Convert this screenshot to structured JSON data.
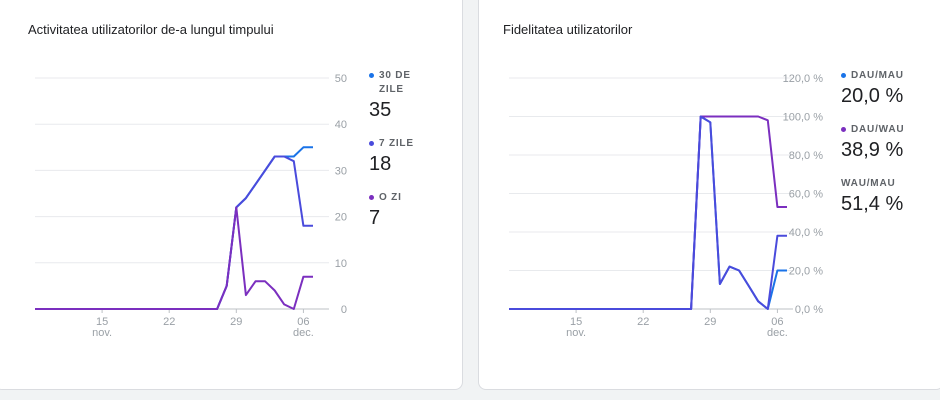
{
  "cards": [
    {
      "title": "Activitatea utilizatorilor de-a lungul timpului"
    },
    {
      "title": "Fidelitatea utilizatorilor"
    }
  ],
  "legend_left": [
    {
      "label": "30 DE ZILE",
      "value": "35",
      "color": "#1a73e8"
    },
    {
      "label": "7 ZILE",
      "value": "18",
      "color": "#4a4bdc"
    },
    {
      "label": "O ZI",
      "value": "7",
      "color": "#7b2fbf"
    }
  ],
  "legend_right": [
    {
      "label": "DAU/MAU",
      "value": "20,0 %",
      "color": "#1a73e8"
    },
    {
      "label": "DAU/WAU",
      "value": "38,9 %",
      "color": "#7b2fbf"
    },
    {
      "label": "WAU/MAU",
      "value": "51,4 %",
      "color": ""
    }
  ],
  "chart_data": [
    {
      "type": "line",
      "title": "Activitatea utilizatorilor de-a lungul timpului",
      "x": [
        "Nov 8",
        "Nov 9",
        "Nov 10",
        "Nov 11",
        "Nov 12",
        "Nov 13",
        "Nov 14",
        "Nov 15",
        "Nov 16",
        "Nov 17",
        "Nov 18",
        "Nov 19",
        "Nov 20",
        "Nov 21",
        "Nov 22",
        "Nov 23",
        "Nov 24",
        "Nov 25",
        "Nov 26",
        "Nov 27",
        "Nov 28",
        "Nov 29",
        "Nov 30",
        "Dec 1",
        "Dec 2",
        "Dec 3",
        "Dec 4",
        "Dec 5",
        "Dec 6",
        "Dec 7"
      ],
      "x_ticks": [
        {
          "index": 7,
          "day": "15",
          "month": "nov."
        },
        {
          "index": 14,
          "day": "22",
          "month": ""
        },
        {
          "index": 21,
          "day": "29",
          "month": ""
        },
        {
          "index": 28,
          "day": "06",
          "month": "dec."
        }
      ],
      "y_ticks": [
        "0",
        "10",
        "20",
        "30",
        "40",
        "50"
      ],
      "ylim": [
        0,
        50
      ],
      "grid": true,
      "legend_position": "right",
      "series": [
        {
          "name": "30 DE ZILE",
          "color": "#1a73e8",
          "values": [
            0,
            0,
            0,
            0,
            0,
            0,
            0,
            0,
            0,
            0,
            0,
            0,
            0,
            0,
            0,
            0,
            0,
            0,
            0,
            0,
            5,
            22,
            24,
            27,
            30,
            33,
            33,
            33,
            35,
            35
          ]
        },
        {
          "name": "7 ZILE",
          "color": "#4a4bdc",
          "values": [
            0,
            0,
            0,
            0,
            0,
            0,
            0,
            0,
            0,
            0,
            0,
            0,
            0,
            0,
            0,
            0,
            0,
            0,
            0,
            0,
            5,
            22,
            24,
            27,
            30,
            33,
            33,
            32,
            18,
            18
          ]
        },
        {
          "name": "O ZI",
          "color": "#7b2fbf",
          "values": [
            0,
            0,
            0,
            0,
            0,
            0,
            0,
            0,
            0,
            0,
            0,
            0,
            0,
            0,
            0,
            0,
            0,
            0,
            0,
            0,
            5,
            22,
            3,
            6,
            6,
            4,
            1,
            0,
            7,
            7
          ]
        }
      ]
    },
    {
      "type": "line",
      "title": "Fidelitatea utilizatorilor",
      "x": [
        "Nov 8",
        "Nov 9",
        "Nov 10",
        "Nov 11",
        "Nov 12",
        "Nov 13",
        "Nov 14",
        "Nov 15",
        "Nov 16",
        "Nov 17",
        "Nov 18",
        "Nov 19",
        "Nov 20",
        "Nov 21",
        "Nov 22",
        "Nov 23",
        "Nov 24",
        "Nov 25",
        "Nov 26",
        "Nov 27",
        "Nov 28",
        "Nov 29",
        "Nov 30",
        "Dec 1",
        "Dec 2",
        "Dec 3",
        "Dec 4",
        "Dec 5",
        "Dec 6",
        "Dec 7"
      ],
      "x_ticks": [
        {
          "index": 7,
          "day": "15",
          "month": "nov."
        },
        {
          "index": 14,
          "day": "22",
          "month": ""
        },
        {
          "index": 21,
          "day": "29",
          "month": ""
        },
        {
          "index": 28,
          "day": "06",
          "month": "dec."
        }
      ],
      "y_ticks": [
        "0,0 %",
        "20,0 %",
        "40,0 %",
        "60,0 %",
        "80,0 %",
        "100,0 %",
        "120,0 %"
      ],
      "ylim": [
        0,
        120
      ],
      "grid": true,
      "legend_position": "right",
      "series": [
        {
          "name": "DAU/MAU",
          "color": "#1a73e8",
          "values": [
            0,
            0,
            0,
            0,
            0,
            0,
            0,
            0,
            0,
            0,
            0,
            0,
            0,
            0,
            0,
            0,
            0,
            0,
            0,
            0,
            100,
            97,
            13,
            22,
            20,
            12,
            4,
            0,
            20,
            20
          ]
        },
        {
          "name": "DAU/WAU",
          "color": "#7b2fbf",
          "values": [
            0,
            0,
            0,
            0,
            0,
            0,
            0,
            0,
            0,
            0,
            0,
            0,
            0,
            0,
            0,
            0,
            0,
            0,
            0,
            0,
            100,
            100,
            100,
            100,
            100,
            100,
            100,
            98,
            53,
            53
          ]
        },
        {
          "name": "WAU/MAU",
          "color": "#4a4bdc",
          "values": [
            0,
            0,
            0,
            0,
            0,
            0,
            0,
            0,
            0,
            0,
            0,
            0,
            0,
            0,
            0,
            0,
            0,
            0,
            0,
            0,
            100,
            97,
            13,
            22,
            20,
            12,
            4,
            0,
            38,
            38
          ]
        }
      ]
    }
  ]
}
